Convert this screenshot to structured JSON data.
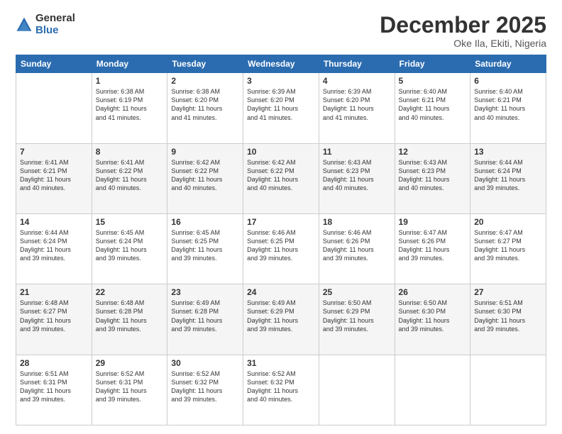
{
  "logo": {
    "general": "General",
    "blue": "Blue"
  },
  "title": {
    "month_year": "December 2025",
    "location": "Oke Ila, Ekiti, Nigeria"
  },
  "weekdays": [
    "Sunday",
    "Monday",
    "Tuesday",
    "Wednesday",
    "Thursday",
    "Friday",
    "Saturday"
  ],
  "weeks": [
    [
      {
        "day": "",
        "info": ""
      },
      {
        "day": "1",
        "info": "Sunrise: 6:38 AM\nSunset: 6:19 PM\nDaylight: 11 hours\nand 41 minutes."
      },
      {
        "day": "2",
        "info": "Sunrise: 6:38 AM\nSunset: 6:20 PM\nDaylight: 11 hours\nand 41 minutes."
      },
      {
        "day": "3",
        "info": "Sunrise: 6:39 AM\nSunset: 6:20 PM\nDaylight: 11 hours\nand 41 minutes."
      },
      {
        "day": "4",
        "info": "Sunrise: 6:39 AM\nSunset: 6:20 PM\nDaylight: 11 hours\nand 41 minutes."
      },
      {
        "day": "5",
        "info": "Sunrise: 6:40 AM\nSunset: 6:21 PM\nDaylight: 11 hours\nand 40 minutes."
      },
      {
        "day": "6",
        "info": "Sunrise: 6:40 AM\nSunset: 6:21 PM\nDaylight: 11 hours\nand 40 minutes."
      }
    ],
    [
      {
        "day": "7",
        "info": "Sunrise: 6:41 AM\nSunset: 6:21 PM\nDaylight: 11 hours\nand 40 minutes."
      },
      {
        "day": "8",
        "info": "Sunrise: 6:41 AM\nSunset: 6:22 PM\nDaylight: 11 hours\nand 40 minutes."
      },
      {
        "day": "9",
        "info": "Sunrise: 6:42 AM\nSunset: 6:22 PM\nDaylight: 11 hours\nand 40 minutes."
      },
      {
        "day": "10",
        "info": "Sunrise: 6:42 AM\nSunset: 6:22 PM\nDaylight: 11 hours\nand 40 minutes."
      },
      {
        "day": "11",
        "info": "Sunrise: 6:43 AM\nSunset: 6:23 PM\nDaylight: 11 hours\nand 40 minutes."
      },
      {
        "day": "12",
        "info": "Sunrise: 6:43 AM\nSunset: 6:23 PM\nDaylight: 11 hours\nand 40 minutes."
      },
      {
        "day": "13",
        "info": "Sunrise: 6:44 AM\nSunset: 6:24 PM\nDaylight: 11 hours\nand 39 minutes."
      }
    ],
    [
      {
        "day": "14",
        "info": "Sunrise: 6:44 AM\nSunset: 6:24 PM\nDaylight: 11 hours\nand 39 minutes."
      },
      {
        "day": "15",
        "info": "Sunrise: 6:45 AM\nSunset: 6:24 PM\nDaylight: 11 hours\nand 39 minutes."
      },
      {
        "day": "16",
        "info": "Sunrise: 6:45 AM\nSunset: 6:25 PM\nDaylight: 11 hours\nand 39 minutes."
      },
      {
        "day": "17",
        "info": "Sunrise: 6:46 AM\nSunset: 6:25 PM\nDaylight: 11 hours\nand 39 minutes."
      },
      {
        "day": "18",
        "info": "Sunrise: 6:46 AM\nSunset: 6:26 PM\nDaylight: 11 hours\nand 39 minutes."
      },
      {
        "day": "19",
        "info": "Sunrise: 6:47 AM\nSunset: 6:26 PM\nDaylight: 11 hours\nand 39 minutes."
      },
      {
        "day": "20",
        "info": "Sunrise: 6:47 AM\nSunset: 6:27 PM\nDaylight: 11 hours\nand 39 minutes."
      }
    ],
    [
      {
        "day": "21",
        "info": "Sunrise: 6:48 AM\nSunset: 6:27 PM\nDaylight: 11 hours\nand 39 minutes."
      },
      {
        "day": "22",
        "info": "Sunrise: 6:48 AM\nSunset: 6:28 PM\nDaylight: 11 hours\nand 39 minutes."
      },
      {
        "day": "23",
        "info": "Sunrise: 6:49 AM\nSunset: 6:28 PM\nDaylight: 11 hours\nand 39 minutes."
      },
      {
        "day": "24",
        "info": "Sunrise: 6:49 AM\nSunset: 6:29 PM\nDaylight: 11 hours\nand 39 minutes."
      },
      {
        "day": "25",
        "info": "Sunrise: 6:50 AM\nSunset: 6:29 PM\nDaylight: 11 hours\nand 39 minutes."
      },
      {
        "day": "26",
        "info": "Sunrise: 6:50 AM\nSunset: 6:30 PM\nDaylight: 11 hours\nand 39 minutes."
      },
      {
        "day": "27",
        "info": "Sunrise: 6:51 AM\nSunset: 6:30 PM\nDaylight: 11 hours\nand 39 minutes."
      }
    ],
    [
      {
        "day": "28",
        "info": "Sunrise: 6:51 AM\nSunset: 6:31 PM\nDaylight: 11 hours\nand 39 minutes."
      },
      {
        "day": "29",
        "info": "Sunrise: 6:52 AM\nSunset: 6:31 PM\nDaylight: 11 hours\nand 39 minutes."
      },
      {
        "day": "30",
        "info": "Sunrise: 6:52 AM\nSunset: 6:32 PM\nDaylight: 11 hours\nand 39 minutes."
      },
      {
        "day": "31",
        "info": "Sunrise: 6:52 AM\nSunset: 6:32 PM\nDaylight: 11 hours\nand 40 minutes."
      },
      {
        "day": "",
        "info": ""
      },
      {
        "day": "",
        "info": ""
      },
      {
        "day": "",
        "info": ""
      }
    ]
  ]
}
